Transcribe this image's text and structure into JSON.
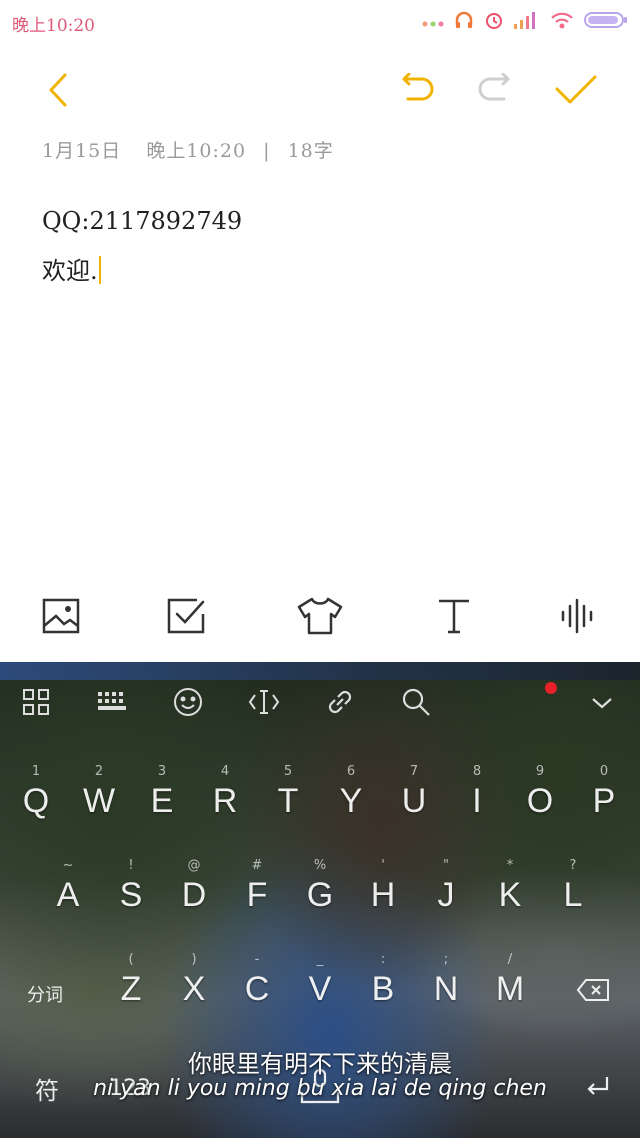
{
  "status_bar": {
    "time": "晚上10:20",
    "icons": [
      "more-dots-icon",
      "headphones-icon",
      "alarm-icon",
      "signal-icon",
      "wifi-icon",
      "battery-icon"
    ]
  },
  "header": {
    "back_icon": "back-chevron-icon",
    "undo_icon": "undo-icon",
    "redo_icon": "redo-icon",
    "done_icon": "checkmark-icon",
    "accent_color": "#f0b400"
  },
  "note": {
    "date": "1月15日",
    "time": "晚上10:20",
    "separator": "|",
    "char_count": "18字",
    "lines": [
      "QQ:2117892749",
      "欢迎."
    ]
  },
  "format_toolbar": {
    "items": [
      "image-icon",
      "checkbox-icon",
      "shirt-icon",
      "text-format-icon",
      "voice-wave-icon"
    ]
  },
  "keyboard": {
    "toolbar_icons": [
      "grid-menu-icon",
      "keyboard-icon",
      "emoji-icon",
      "cursor-icon",
      "link-icon",
      "search-icon",
      "collapse-chevron-icon"
    ],
    "row1": {
      "keys": [
        "Q",
        "W",
        "E",
        "R",
        "T",
        "Y",
        "U",
        "I",
        "O",
        "P"
      ],
      "hints": [
        "1",
        "2",
        "3",
        "4",
        "5",
        "6",
        "7",
        "8",
        "9",
        "0"
      ]
    },
    "row2": {
      "keys": [
        "A",
        "S",
        "D",
        "F",
        "G",
        "H",
        "J",
        "K",
        "L"
      ],
      "hints": [
        "~",
        "!",
        "@",
        "#",
        "%",
        "'",
        "\"",
        "*",
        "?"
      ]
    },
    "row3": {
      "keys": [
        "Z",
        "X",
        "C",
        "V",
        "B",
        "N",
        "M"
      ],
      "hints": [
        "(",
        ")",
        "-",
        "_",
        ":",
        ";",
        "/"
      ]
    },
    "segment_key": "分词",
    "symbol_key": "符",
    "number_key": "123",
    "lyric_chinese": "你眼里有明不下来的清晨",
    "lyric_pinyin": "ni yan li you ming bu xia lai de qing chen"
  }
}
